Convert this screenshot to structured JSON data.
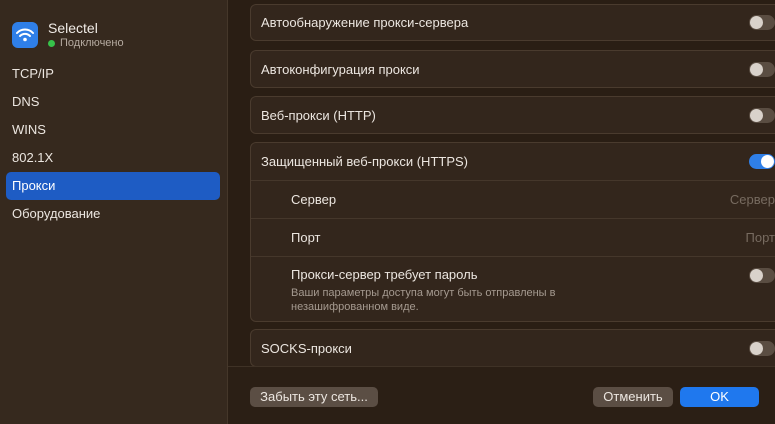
{
  "sidebar": {
    "network_name": "Selectel",
    "network_status": "Подключено",
    "items": [
      {
        "label": "TCP/IP"
      },
      {
        "label": "DNS"
      },
      {
        "label": "WINS"
      },
      {
        "label": "802.1X"
      },
      {
        "label": "Прокси",
        "active": true
      },
      {
        "label": "Оборудование"
      }
    ],
    "icons": {
      "wifi": "wifi-icon",
      "status": "green-dot"
    }
  },
  "proxy": {
    "auto_discovery": {
      "label": "Автообнаружение прокси-сервера",
      "enabled": false
    },
    "auto_config": {
      "label": "Автоконфигурация прокси",
      "enabled": false
    },
    "web_http": {
      "label": "Веб-прокси (HTTP)",
      "enabled": false
    },
    "web_https": {
      "label": "Защищенный веб-прокси (HTTPS)",
      "enabled": true,
      "server_label": "Сервер",
      "server_placeholder": "Сервер",
      "port_label": "Порт",
      "port_placeholder": "Порт",
      "password_label": "Прокси-сервер требует пароль",
      "password_enabled": false,
      "password_hint": "Ваши параметры доступа могут быть отправлены в незашифрованном виде."
    },
    "socks": {
      "label": "SOCKS-прокси",
      "enabled": false
    }
  },
  "footer": {
    "forget_label": "Забыть эту сеть...",
    "cancel_label": "Отменить",
    "ok_label": "OK"
  },
  "colors": {
    "accent": "#1f78ee",
    "sidebar_active": "#1e5cc4",
    "status_connected": "#37c24a"
  }
}
